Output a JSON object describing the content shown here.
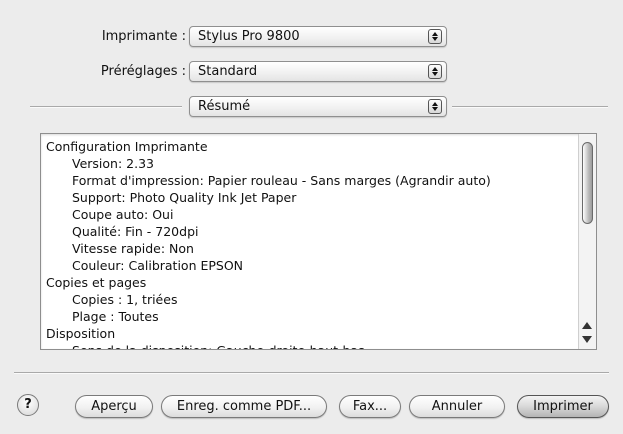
{
  "printer": {
    "label": "Imprimante :",
    "value": "Stylus Pro 9800"
  },
  "presets": {
    "label": "Préréglages :",
    "value": "Standard"
  },
  "panel": {
    "value": "Résumé"
  },
  "summary": {
    "rows": [
      {
        "text": "Configuration Imprimante",
        "indent": false
      },
      {
        "text": "Version:  2.33",
        "indent": true
      },
      {
        "text": "Format d'impression:  Papier rouleau - Sans marges (Agrandir auto)",
        "indent": true
      },
      {
        "text": "Support:  Photo Quality Ink Jet Paper",
        "indent": true
      },
      {
        "text": "Coupe auto:  Oui",
        "indent": true
      },
      {
        "text": "Qualité:  Fin - 720dpi",
        "indent": true
      },
      {
        "text": "Vitesse rapide:  Non",
        "indent": true
      },
      {
        "text": "Couleur:  Calibration EPSON",
        "indent": true
      },
      {
        "text": "Copies et pages",
        "indent": false
      },
      {
        "text": "Copies :  1, triées",
        "indent": true
      },
      {
        "text": "Plage :  Toutes",
        "indent": true
      },
      {
        "text": "Disposition",
        "indent": false
      },
      {
        "text": "Sens de la disposition:  Gauche-droite-haut-bas",
        "indent": true
      }
    ]
  },
  "buttons": {
    "help": "?",
    "preview": "Aperçu",
    "save_pdf": "Enreg. comme PDF...",
    "fax": "Fax...",
    "cancel": "Annuler",
    "print": "Imprimer"
  }
}
